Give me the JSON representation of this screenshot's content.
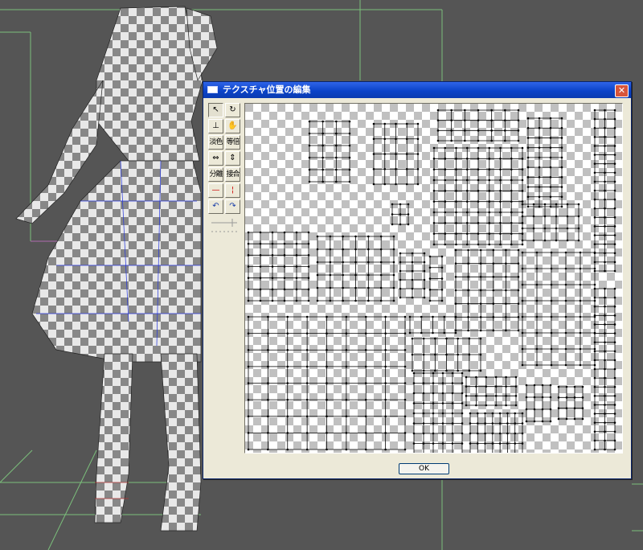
{
  "dialog": {
    "title": "テクスチャ位置の編集",
    "close_glyph": "✕",
    "ok_label": "OK"
  },
  "toolbar": {
    "select_glyph": "↖",
    "rotate_glyph": "↻",
    "fit_glyph": "⊥",
    "pan_glyph": "✋",
    "light_color_label": "淡色",
    "equal_scale_label": "等倍",
    "flip_h_glyph": "⇔",
    "flip_v_glyph": "⇕",
    "separate_label": "分離",
    "merge_label": "接合",
    "align_h_glyph": "—",
    "align_v_glyph": "¦",
    "undo_glyph": "↶",
    "redo_glyph": "↷"
  },
  "colors": {
    "dialog_face": "#ece9d8",
    "titlebar": "#0b43c9",
    "close_button": "#d7553b",
    "checker_light": "#ffffff",
    "checker_dark": "#c0c0c0",
    "viewport_bg": "#555555",
    "grid_green": "#7bbf7b",
    "wire_blue": "#2233dd",
    "wire_red": "#b33333"
  },
  "icons": [
    "arrow-cursor-icon",
    "rotate-icon",
    "fit-icon",
    "hand-icon",
    "flip-horizontal-icon",
    "flip-vertical-icon",
    "align-horizontal-icon",
    "align-vertical-icon",
    "undo-icon",
    "redo-icon",
    "close-icon",
    "window-icon"
  ]
}
